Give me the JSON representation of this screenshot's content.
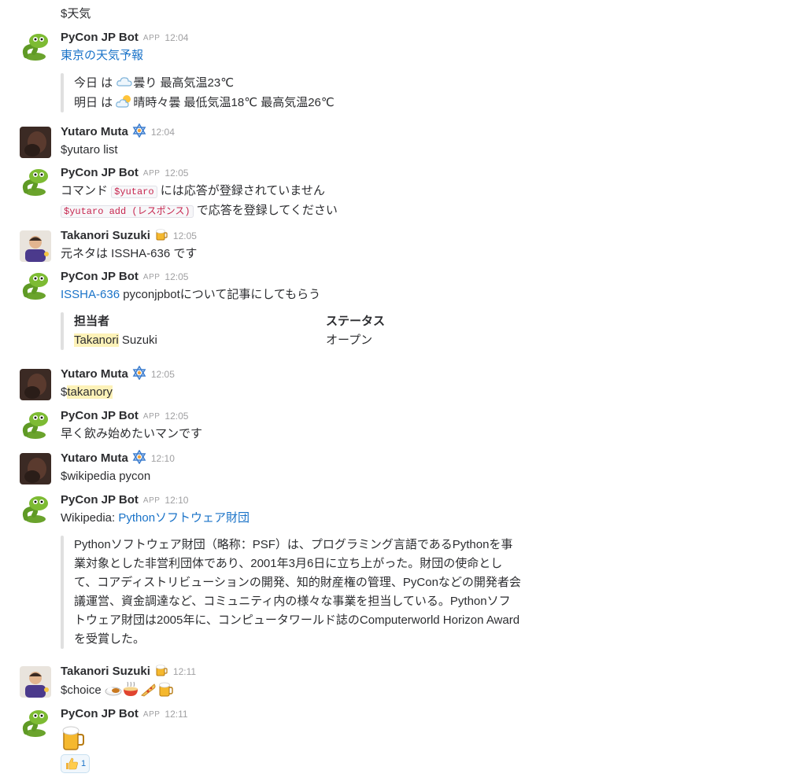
{
  "messages": {
    "m0": {
      "text": "$天気"
    },
    "m1": {
      "author": "PyCon JP Bot",
      "app_badge": "APP",
      "time": "12:04",
      "link": "東京の天気予報",
      "line1": {
        "a": "今日 は ",
        "b": "曇り 最高気温23℃"
      },
      "line2": {
        "a": "明日 は ",
        "b": "晴時々曇 最低気温18℃ 最高気温26℃"
      }
    },
    "m2": {
      "author": "Yutaro Muta",
      "time": "12:04",
      "text": "$yutaro list"
    },
    "m3": {
      "author": "PyCon JP Bot",
      "app_badge": "APP",
      "time": "12:05",
      "l1_a": "コマンド ",
      "l1_code": "$yutaro",
      "l1_b": " には応答が登録されていません",
      "l2_code": "$yutaro add (レスポンス)",
      "l2_b": " で応答を登録してください"
    },
    "m4": {
      "author": "Takanori Suzuki",
      "time": "12:05",
      "text": "元ネタは ISSHA-636 です"
    },
    "m5": {
      "author": "PyCon JP Bot",
      "app_badge": "APP",
      "time": "12:05",
      "link": "ISSHA-636",
      "text": " pyconjpbotについて記事にしてもらう",
      "f1_title": "担当者",
      "f1_hl": "Takanori",
      "f1_rest": " Suzuki",
      "f2_title": "ステータス",
      "f2_value": "オープン"
    },
    "m6": {
      "author": "Yutaro Muta",
      "time": "12:05",
      "prefix": "$",
      "hl": "takanory"
    },
    "m7": {
      "author": "PyCon JP Bot",
      "app_badge": "APP",
      "time": "12:05",
      "text": "早く飲み始めたいマンです"
    },
    "m8": {
      "author": "Yutaro Muta",
      "time": "12:10",
      "text": "$wikipedia pycon"
    },
    "m9": {
      "author": "PyCon JP Bot",
      "app_badge": "APP",
      "time": "12:10",
      "prefix": "Wikipedia: ",
      "link": "Pythonソフトウェア財団",
      "lines": [
        "Pythonソフトウェア財団（略称：PSF）は、プログラミング言語であるPythonを事",
        "業対象とした非営利団体であり、2001年3月6日に立ち上がった。財団の使命とし",
        "て、コアディストリビューションの開発、知的財産権の管理、PyConなどの開発者会",
        "議運営、資金調達など、コミュニティ内の様々な事業を担当している。Pythonソフ",
        "トウェア財団は2005年に、コンピュータワールド誌のComputerworld Horizon Award",
        "を受賞した。"
      ]
    },
    "m10": {
      "author": "Takanori Suzuki",
      "time": "12:11",
      "text": "$choice "
    },
    "m11": {
      "author": "PyCon JP Bot",
      "app_badge": "APP",
      "time": "12:11",
      "reaction_count": "1"
    }
  },
  "icons": {
    "bot_avatar": "snake-avatar",
    "yutaro_avatar": "photo-avatar",
    "takanori_avatar": "photo-avatar",
    "yutaro_status": "star-of-david-icon",
    "takanori_status": "beer-mug-icon",
    "weather_today": "cloud-icon",
    "weather_tomorrow": "sun-behind-cloud-icon",
    "choices": [
      "curry-rice-icon",
      "ramen-icon",
      "pizza-icon",
      "beer-mug-icon"
    ],
    "result": "beer-mug-icon",
    "reaction": "thumbs-up-icon"
  },
  "colors": {
    "link": "#1a73c8",
    "highlight": "#fdf2b8",
    "code": "#c7254e",
    "muted": "#a0a0a2"
  }
}
